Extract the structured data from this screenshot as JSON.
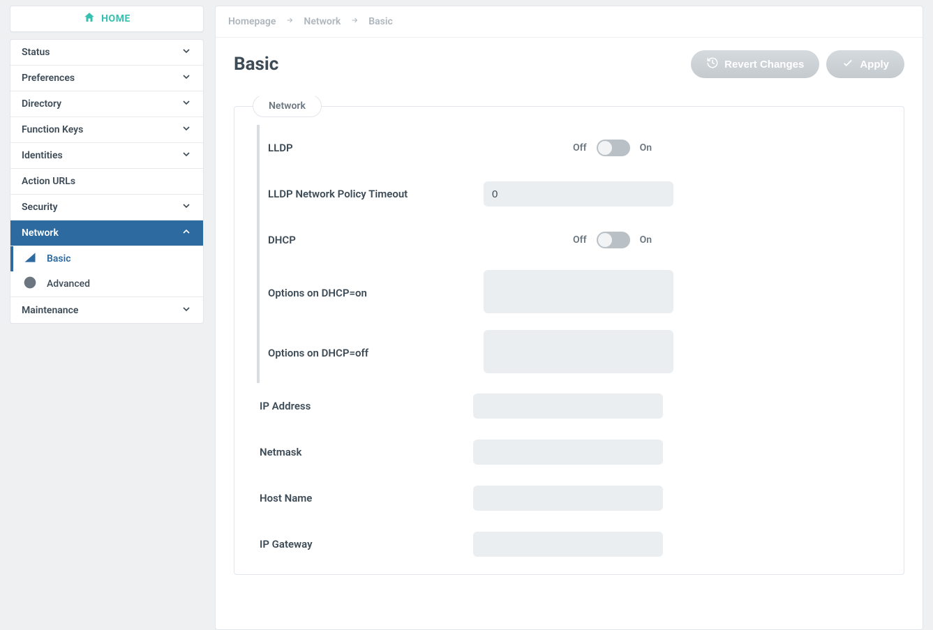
{
  "home_label": "HOME",
  "sidebar": {
    "items": [
      {
        "label": "Status",
        "expandable": true
      },
      {
        "label": "Preferences",
        "expandable": true
      },
      {
        "label": "Directory",
        "expandable": true
      },
      {
        "label": "Function Keys",
        "expandable": true
      },
      {
        "label": "Identities",
        "expandable": true
      },
      {
        "label": "Action URLs",
        "expandable": false
      },
      {
        "label": "Security",
        "expandable": true
      },
      {
        "label": "Network",
        "expandable": true,
        "active": true
      },
      {
        "label": "Maintenance",
        "expandable": true
      }
    ],
    "network_sub": [
      {
        "label": "Basic",
        "active": true
      },
      {
        "label": "Advanced",
        "active": false
      }
    ]
  },
  "breadcrumb": [
    "Homepage",
    "Network",
    "Basic"
  ],
  "page_title": "Basic",
  "buttons": {
    "revert": "Revert Changes",
    "apply": "Apply"
  },
  "panel_label": "Network",
  "toggle_labels": {
    "off": "Off",
    "on": "On"
  },
  "fields": {
    "lldp": {
      "label": "LLDP",
      "value": false
    },
    "lldp_timeout": {
      "label": "LLDP Network Policy Timeout",
      "value": "0"
    },
    "dhcp": {
      "label": "DHCP",
      "value": false
    },
    "opts_on": {
      "label": "Options on DHCP=on",
      "value": ""
    },
    "opts_off": {
      "label": "Options on DHCP=off",
      "value": ""
    },
    "ip": {
      "label": "IP Address",
      "value": ""
    },
    "netmask": {
      "label": "Netmask",
      "value": ""
    },
    "hostname": {
      "label": "Host Name",
      "value": ""
    },
    "gateway": {
      "label": "IP Gateway",
      "value": ""
    }
  }
}
